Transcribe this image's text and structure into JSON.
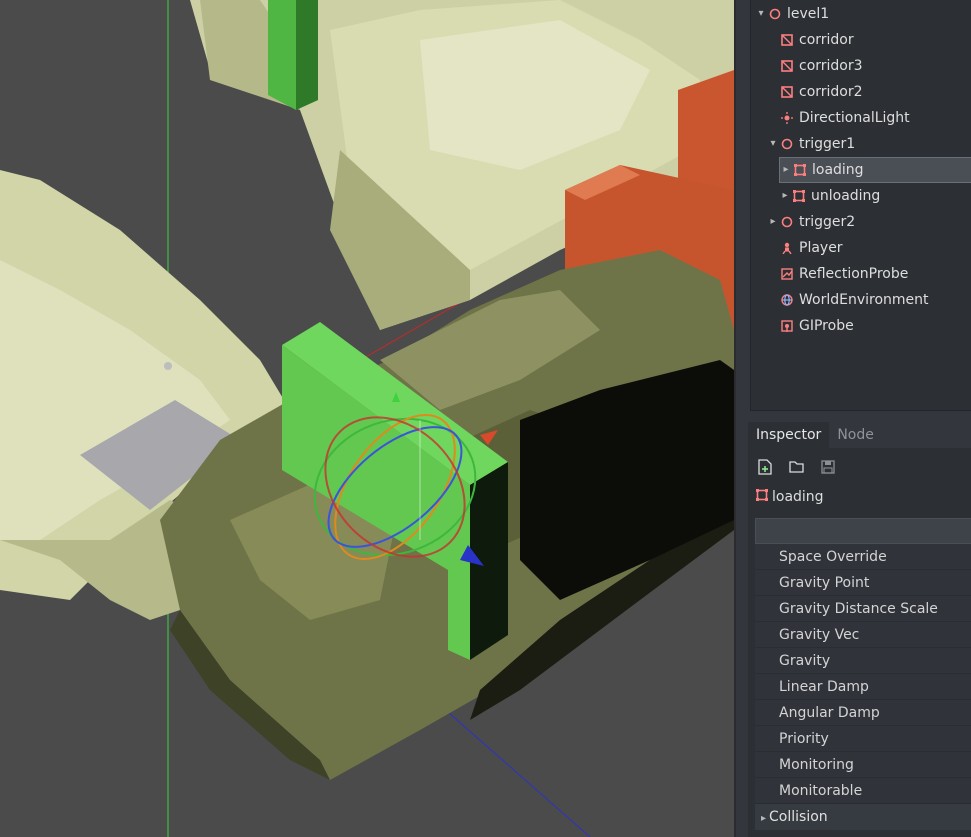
{
  "scene_tree": {
    "items": [
      {
        "label": "level1",
        "icon": "spatial-node-icon",
        "arrow": "v"
      },
      {
        "label": "corridor",
        "icon": "mesh-instance-icon",
        "arrow": ""
      },
      {
        "label": "corridor3",
        "icon": "mesh-instance-icon",
        "arrow": ""
      },
      {
        "label": "corridor2",
        "icon": "mesh-instance-icon",
        "arrow": ""
      },
      {
        "label": "DirectionalLight",
        "icon": "light-icon",
        "arrow": ""
      },
      {
        "label": "trigger1",
        "icon": "spatial-node-icon",
        "arrow": "v"
      },
      {
        "label": "loading",
        "icon": "area-icon",
        "arrow": ">"
      },
      {
        "label": "unloading",
        "icon": "area-icon",
        "arrow": ">"
      },
      {
        "label": "trigger2",
        "icon": "spatial-node-icon",
        "arrow": ">"
      },
      {
        "label": "Player",
        "icon": "kinematic-body-icon",
        "arrow": ""
      },
      {
        "label": "ReflectionProbe",
        "icon": "reflection-probe-icon",
        "arrow": ""
      },
      {
        "label": "WorldEnvironment",
        "icon": "world-environment-icon",
        "arrow": ""
      },
      {
        "label": "GIProbe",
        "icon": "gi-probe-icon",
        "arrow": ""
      }
    ]
  },
  "inspector": {
    "tabs": [
      "Inspector",
      "Node"
    ],
    "object_name": "loading",
    "properties": [
      "Space Override",
      "Gravity Point",
      "Gravity Distance Scale",
      "Gravity Vec",
      "Gravity",
      "Linear Damp",
      "Angular Damp",
      "Priority",
      "Monitoring",
      "Monitorable"
    ],
    "section": "Collision"
  },
  "colors": {
    "node_icon": "#fc7f7f",
    "accent": "#e0e0e0",
    "wall_light": "#d6d9ad",
    "wall_dark": "#6e7446",
    "door_orange": "#c6552e",
    "trigger_green": "#5cc74d"
  }
}
